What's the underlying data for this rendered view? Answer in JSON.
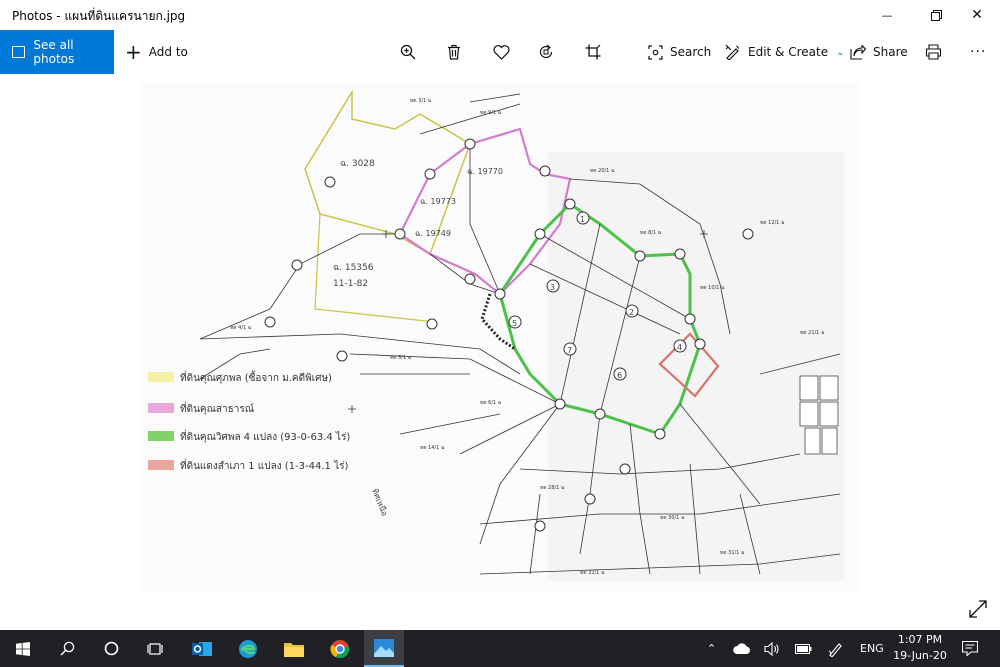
{
  "window": {
    "title": "Photos - แผนที่ดินแครนายก.jpg",
    "minimize": "—",
    "close": "✕"
  },
  "toolbar": {
    "see_all": "See all photos",
    "add_to": "Add to",
    "search": "Search",
    "edit_create": "Edit & Create",
    "share": "Share",
    "more": "···"
  },
  "photo": {
    "map_labels": [
      "ฉ. 3028",
      "ฉ. 15356",
      "11-1-82",
      "ฉ. 19773",
      "ฉ. 19749",
      "ฉ. 19770",
      "1",
      "2",
      "3",
      "4",
      "5",
      "6",
      "7"
    ],
    "legend": [
      {
        "text": "ที่ดินคุณศุภพล (ซื้อจาก ม.คดีพิเศษ)",
        "color": "#f4f0a6"
      },
      {
        "text": "ที่ดินคุณสาธารณ์",
        "color": "#e9a7dd"
      },
      {
        "text": "ที่ดินคุณวิศพล 4 แปลง (93-0-63.4 ไร่)",
        "color": "#7fd36a"
      },
      {
        "text": "ที่ดินแดงสำเภา 1 แปลง (1-3-44.1 ไร่)",
        "color": "#e8a79c"
      }
    ],
    "north_label": "ทิศเหนือ"
  },
  "taskbar": {
    "lang": "ENG",
    "time": "1:07 PM",
    "date": "19-Jun-20"
  },
  "colors": {
    "accent": "#0078d7",
    "taskbar": "#1f2124",
    "green_parcel": "#4cc14a",
    "pink_parcel": "#d27bd0",
    "yellow_parcel": "#e4df52",
    "red_parcel": "#d9726a"
  }
}
